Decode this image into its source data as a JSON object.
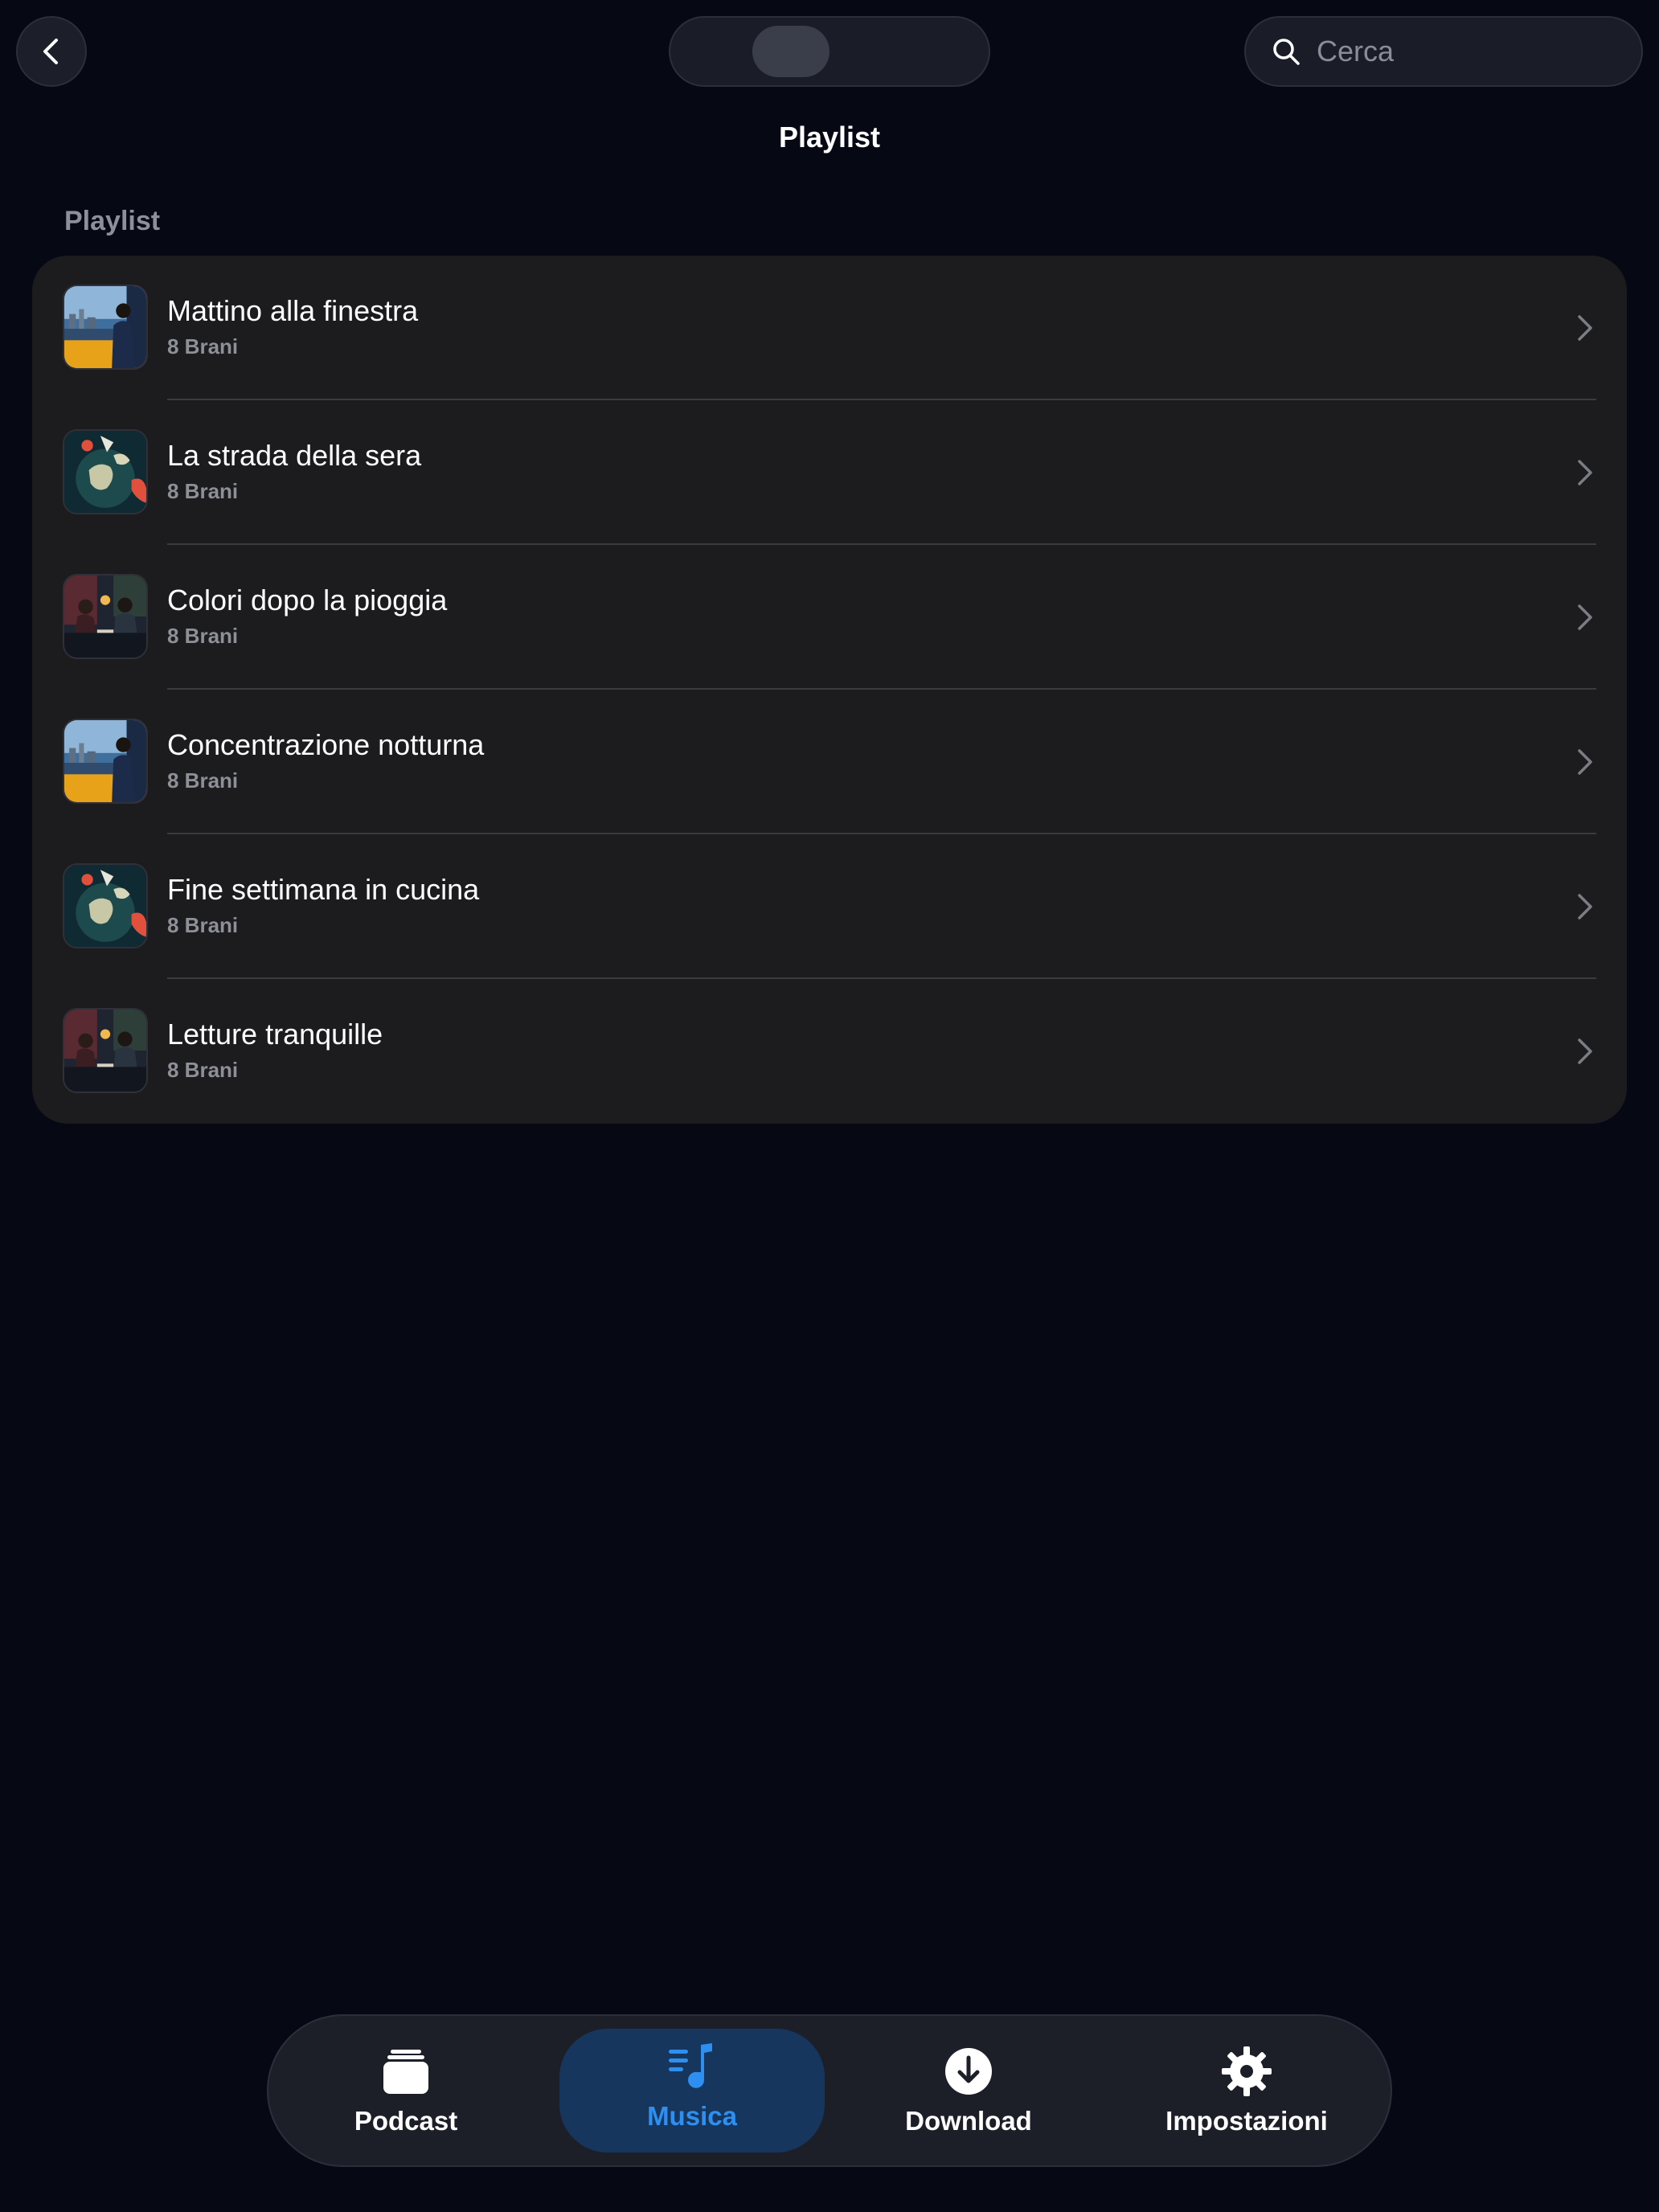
{
  "header": {
    "title": "Playlist",
    "search_placeholder": "Cerca",
    "back_icon": "chevron-left-icon",
    "search_icon": "magnifier-icon"
  },
  "section": {
    "label": "Playlist"
  },
  "playlists": [
    {
      "title": "Mattino alla finestra",
      "subtitle": "8 Brani",
      "artwork": "city-window-art"
    },
    {
      "title": "La strada della sera",
      "subtitle": "8 Brani",
      "artwork": "globe-art"
    },
    {
      "title": "Colori dopo la pioggia",
      "subtitle": "8 Brani",
      "artwork": "cafe-couple-art"
    },
    {
      "title": "Concentrazione notturna",
      "subtitle": "8 Brani",
      "artwork": "city-window-art"
    },
    {
      "title": "Fine settimana in cucina",
      "subtitle": "8 Brani",
      "artwork": "globe-art"
    },
    {
      "title": "Letture tranquille",
      "subtitle": "8 Brani",
      "artwork": "cafe-couple-art"
    }
  ],
  "tabs": [
    {
      "label": "Podcast",
      "icon": "stack-icon",
      "active": false
    },
    {
      "label": "Musica",
      "icon": "music-list-icon",
      "active": true
    },
    {
      "label": "Download",
      "icon": "download-circle-icon",
      "active": false
    },
    {
      "label": "Impostazioni",
      "icon": "gear-icon",
      "active": false
    }
  ],
  "colors": {
    "background": "#060814",
    "card": "#1c1c1f",
    "accent": "#2f8ff0",
    "active_tab_bg": "#16365e",
    "secondary_text": "#8e9098"
  }
}
